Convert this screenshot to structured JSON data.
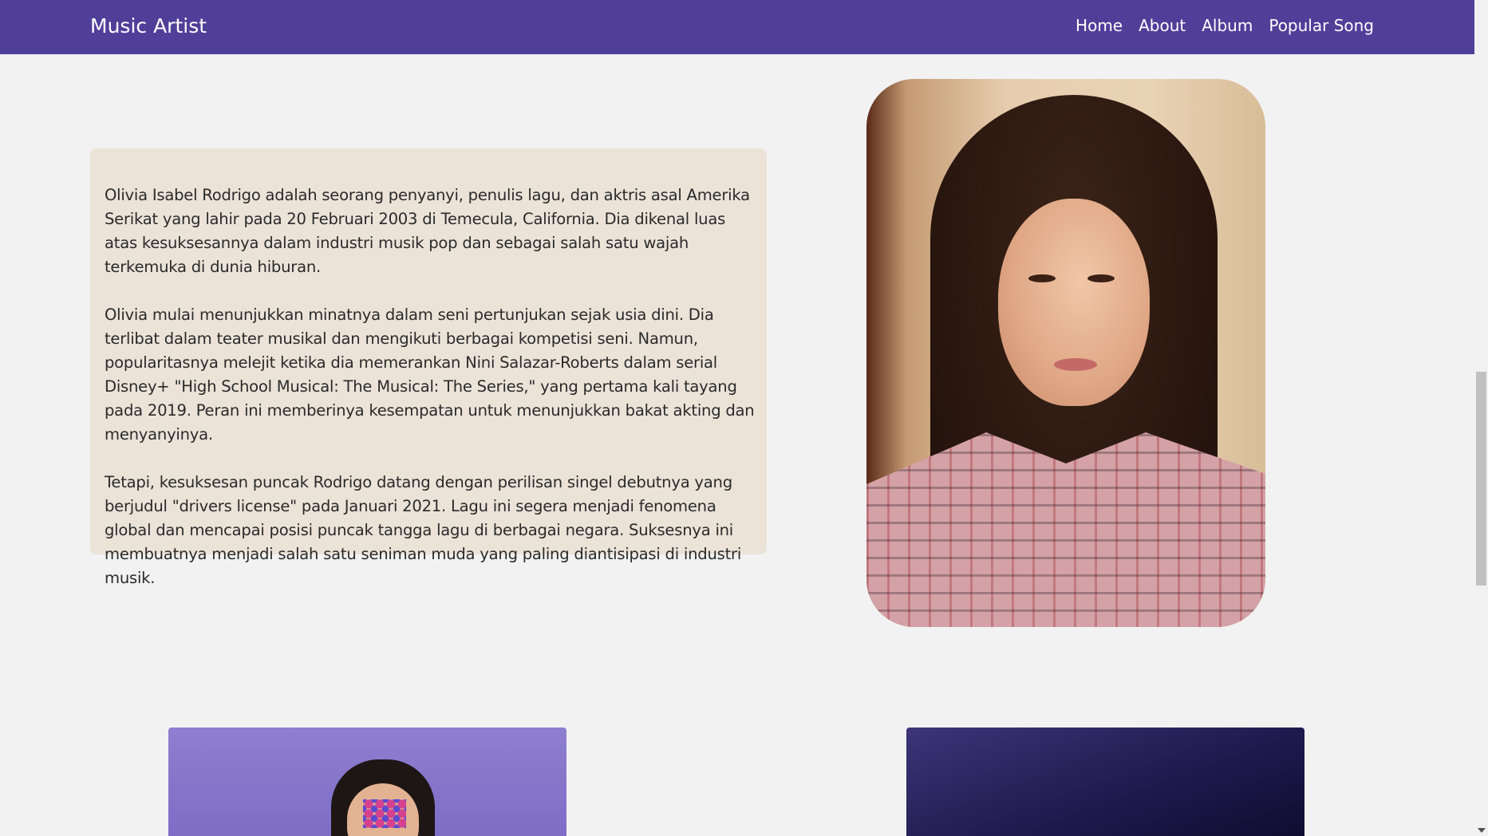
{
  "navbar": {
    "brand": "Music Artist",
    "links": [
      "Home",
      "About",
      "Album",
      "Popular Song"
    ]
  },
  "about": {
    "paragraphs": [
      "Olivia Isabel Rodrigo adalah seorang penyanyi, penulis lagu, dan aktris asal Amerika Serikat yang lahir pada 20 Februari 2003 di Temecula, California. Dia dikenal luas atas kesuksesannya dalam industri musik pop dan sebagai salah satu wajah terkemuka di dunia hiburan.",
      "Olivia mulai menunjukkan minatnya dalam seni pertunjukan sejak usia dini. Dia terlibat dalam teater musikal dan mengikuti berbagai kompetisi seni. Namun, popularitasnya melejit ketika dia memerankan Nini Salazar-Roberts dalam serial Disney+ \"High School Musical: The Musical: The Series,\" yang pertama kali tayang pada 2019. Peran ini memberinya kesempatan untuk menunjukkan bakat akting dan menyanyinya.",
      "Tetapi, kesuksesan puncak Rodrigo datang dengan perilisan singel debutnya yang berjudul \"drivers license\" pada Januari 2021. Lagu ini segera menjadi fenomena global dan mencapai posisi puncak tangga lagu di berbagai negara. Suksesnya ini membuatnya menjadi salah satu seniman muda yang paling diantisipasi di industri musik."
    ]
  },
  "colors": {
    "navbar": "#4f3f99",
    "card": "#ebe3d8",
    "page": "#f2f2f2"
  }
}
